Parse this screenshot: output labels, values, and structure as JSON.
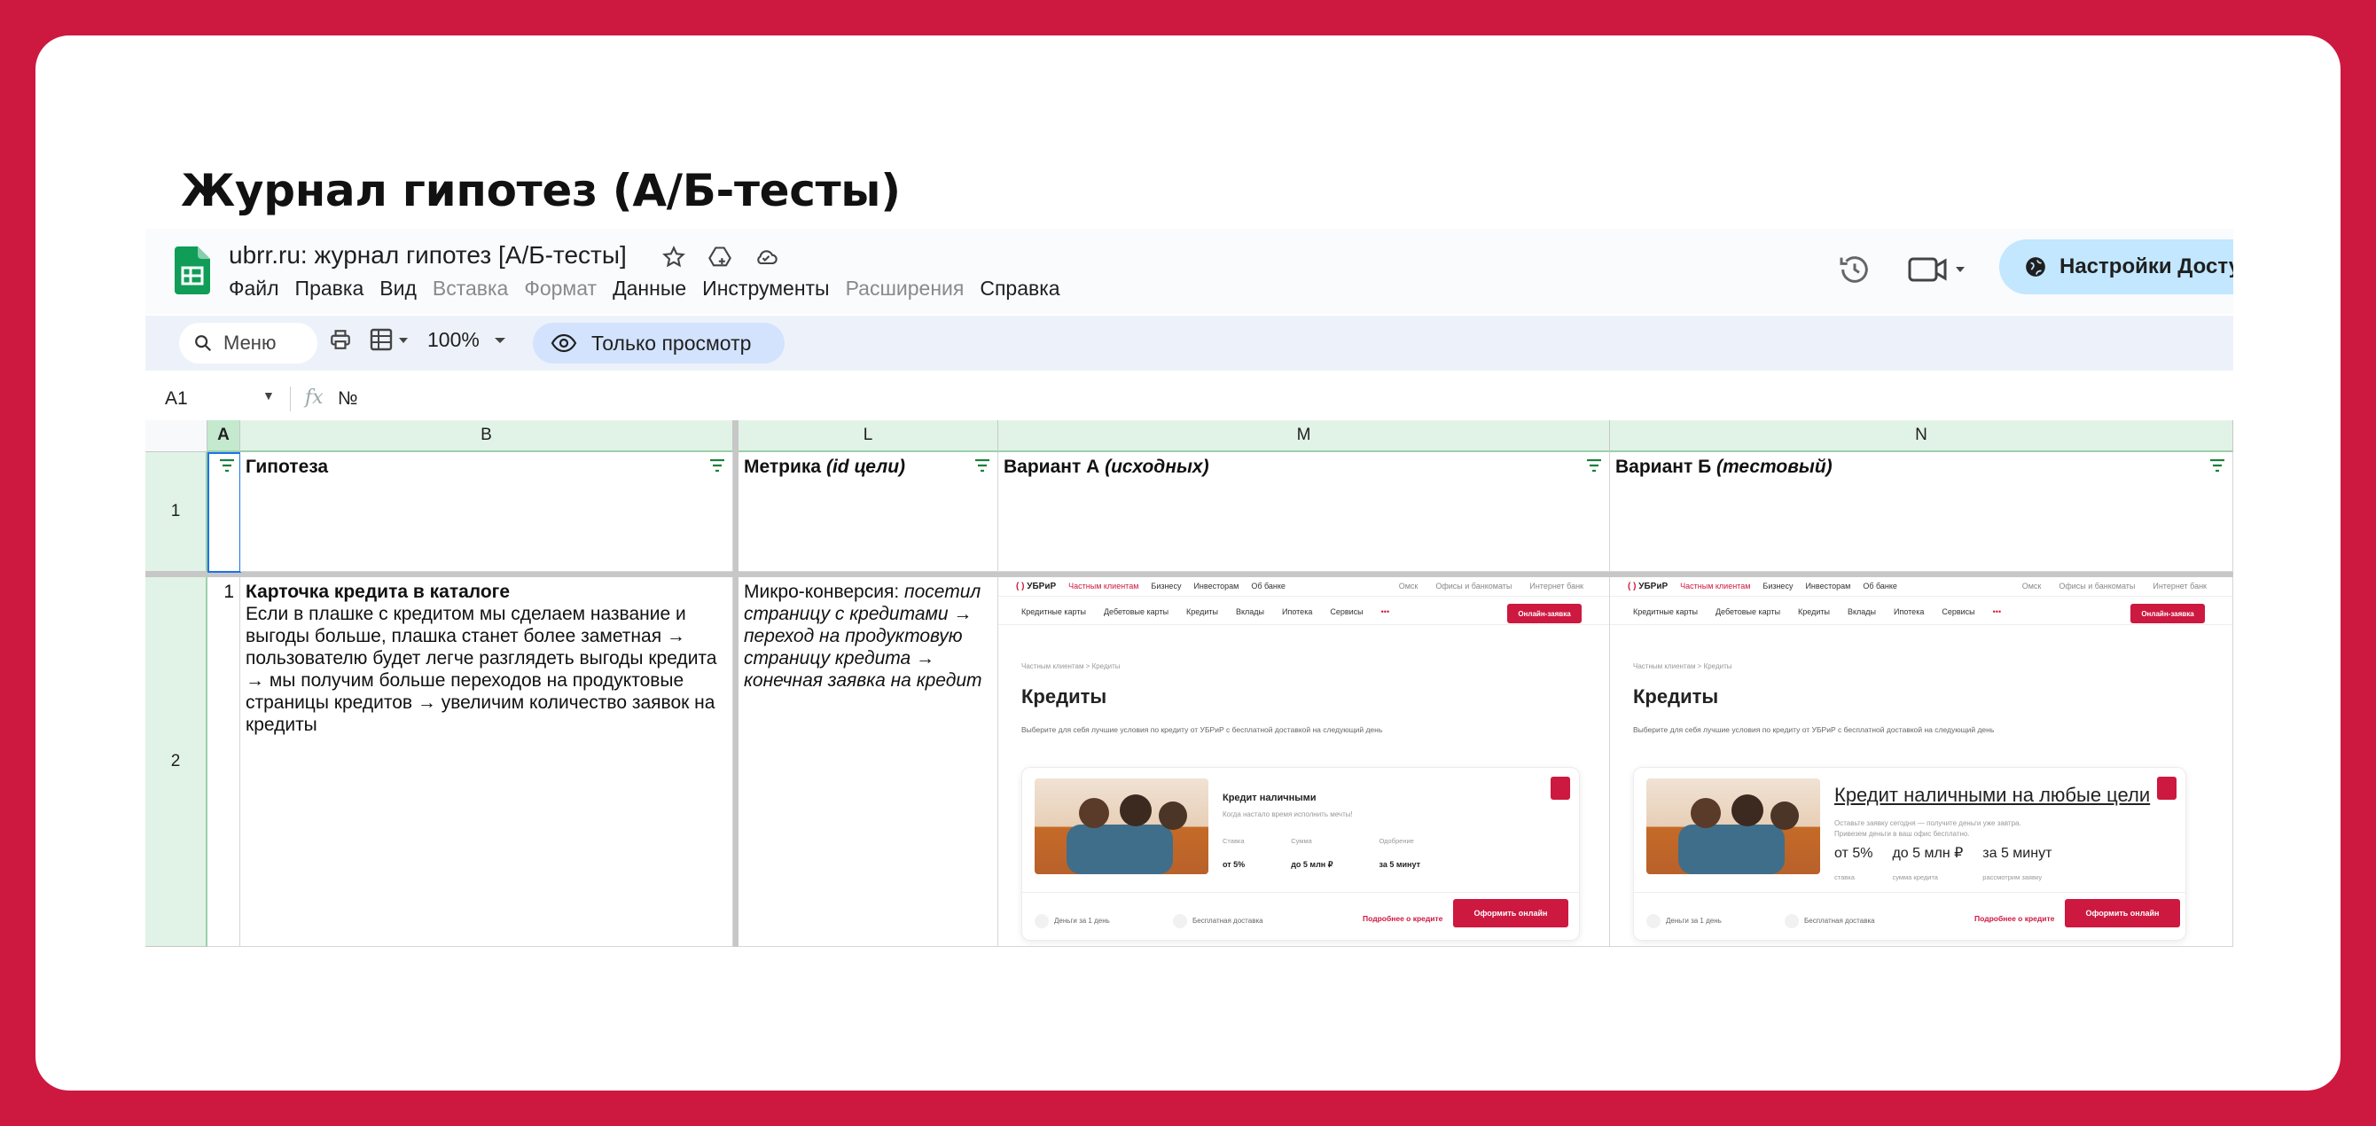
{
  "slide": {
    "title": "Журнал гипотез (А/Б-тесты)"
  },
  "colors": {
    "brand_red": "#cd1840",
    "header_green": "#e1f3e6",
    "share_blue": "#c2e7ff"
  },
  "app": {
    "doc_title": "ubrr.ru: журнал гипотез [А/Б-тесты]",
    "menu": [
      "Файл",
      "Правка",
      "Вид",
      "Вставка",
      "Формат",
      "Данные",
      "Инструменты",
      "Расширения",
      "Справка"
    ],
    "menu_disabled": [
      "Вставка",
      "Формат",
      "Расширения"
    ],
    "share_label": "Настройки Доступ",
    "toolbar": {
      "search_label": "Меню",
      "zoom": "100%",
      "view_only": "Только просмотр"
    },
    "icons": [
      "sheets-logo-icon",
      "star-icon",
      "move-to-drive-icon",
      "cloud-status-icon",
      "history-icon",
      "meet-icon",
      "globe-icon",
      "search-icon",
      "print-icon",
      "format-icon",
      "eye-icon",
      "filter-icon"
    ]
  },
  "formula_bar": {
    "cell_ref": "A1",
    "fx": "fx",
    "value": "№"
  },
  "sheet": {
    "columns": [
      "A",
      "B",
      "L",
      "M",
      "N"
    ],
    "rows": [
      "1",
      "2"
    ],
    "header": {
      "hypothesis": "Гипотеза",
      "metric_plain": "Метрика ",
      "metric_italic": "(id цели)",
      "variant_a_plain": "Вариант А ",
      "variant_a_italic": "(исходных)",
      "variant_b_plain": "Вариант Б ",
      "variant_b_italic": "(тестовый)"
    },
    "row2": {
      "number": "1",
      "hyp_title": "Карточка кредита в каталоге",
      "hyp_body": "Если в плашке с кредитом мы сделаем название и выгоды больше, плашка станет более заметная → пользователю будет легче разглядеть выгоды кредита → мы получим больше переходов на продуктовые страницы кредитов → увеличим количество заявок на кредиты",
      "metric_plain": "Микро-конверсия: ",
      "metric_italic": "посетил страницу с кредитами → переход на продуктовую страницу кредита → конечная заявка на кредит"
    }
  },
  "site": {
    "logo_mark": "( )",
    "logo_text": "УБРиР",
    "nav_top": [
      "Частным клиентам",
      "Бизнесу",
      "Инвесторам",
      "Об банке"
    ],
    "nav_top_right": [
      "Омск",
      "Офисы и банкоматы",
      "Интернет банк"
    ],
    "nav_main": [
      "Кредитные карты",
      "Дебетовые карты",
      "Кредиты",
      "Вклады",
      "Ипотека",
      "Сервисы",
      "•••"
    ],
    "apply_btn": "Онлайн-заявка",
    "crumbs": "Частным клиентам  >  Кредиты",
    "h1": "Кредиты",
    "lead": "Выберите для себя лучшие условия по кредиту от УБРиР с бесплатной доставкой на следующий день",
    "variant_a": {
      "title": "Кредит наличными",
      "sub": "Когда настало время исполнить мечты!",
      "stats": [
        {
          "label": "Ставка",
          "value": "от 5%"
        },
        {
          "label": "Сумма",
          "value": "до 5 млн ₽"
        },
        {
          "label": "Одобрение",
          "value": "за 5 минут"
        }
      ]
    },
    "variant_b": {
      "title": "Кредит наличными на любые цели",
      "sub1": "Оставьте заявку сегодня — получите деньги уже завтра.",
      "sub2": "Привезем деньги в ваш офис бесплатно.",
      "stats": [
        {
          "label": "ставка",
          "value": "от 5%"
        },
        {
          "label": "сумма кредита",
          "value": "до 5 млн ₽"
        },
        {
          "label": "рассмотрим заявку",
          "value": "за 5 минут"
        }
      ]
    },
    "feature1": "Деньги за 1 день",
    "feature2": "Бесплатная доставка",
    "more": "Подробнее о кредите",
    "apply_online": "Оформить онлайн"
  }
}
